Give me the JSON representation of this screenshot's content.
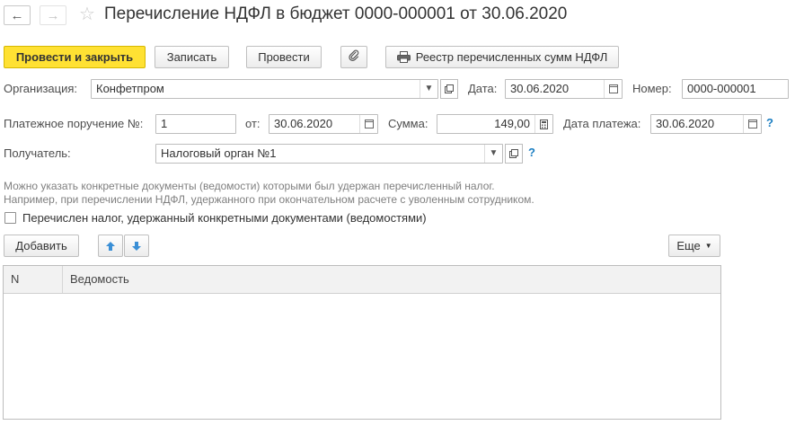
{
  "window": {
    "title": "Перечисление НДФЛ в бюджет 0000-000001 от 30.06.2020",
    "back_icon": "←",
    "forward_icon": "→",
    "favorite_icon": "☆"
  },
  "toolbar": {
    "post_and_close": "Провести и закрыть",
    "save": "Записать",
    "post": "Провести",
    "registry": "Реестр перечисленных сумм НДФЛ"
  },
  "form": {
    "organization_label": "Организация:",
    "organization_value": "Конфетпром",
    "date_label": "Дата:",
    "date_value": "30.06.2020",
    "number_label": "Номер:",
    "number_value": "0000-000001",
    "payment_order_label": "Платежное поручение №:",
    "payment_order_value": "1",
    "from_label": "от:",
    "from_value": "30.06.2020",
    "sum_label": "Сумма:",
    "sum_value": "149,00",
    "payment_date_label": "Дата платежа:",
    "payment_date_value": "30.06.2020",
    "recipient_label": "Получатель:",
    "recipient_value": "Налоговый орган №1",
    "help_mark": "?"
  },
  "hint": {
    "line1": "Можно указать конкретные документы (ведомости) которыми был удержан перечисленный налог.",
    "line2": "Например, при перечислении НДФЛ, удержанного при окончательном расчете с уволенным сотрудником."
  },
  "checkbox": {
    "label": "Перечислен налог, удержанный конкретными документами (ведомостями)",
    "checked": false
  },
  "table_toolbar": {
    "add": "Добавить",
    "more": "Еще"
  },
  "table": {
    "columns": [
      "N",
      "Ведомость"
    ],
    "rows": []
  }
}
